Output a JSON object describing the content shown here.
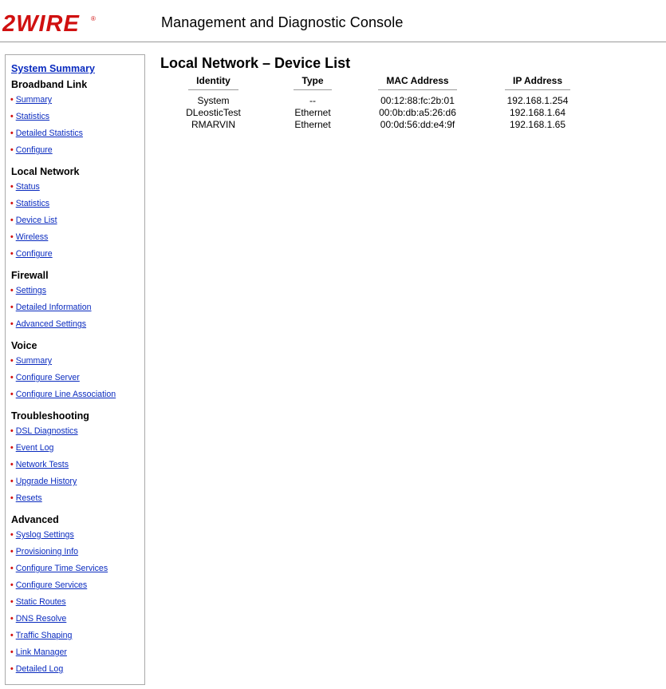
{
  "header": {
    "logo_text": "2WIRE",
    "title": "Management and Diagnostic Console"
  },
  "sidebar": {
    "summary_link": "System Summary",
    "sections": [
      {
        "heading": "Broadband Link",
        "items": [
          "Summary",
          "Statistics",
          "Detailed Statistics",
          "Configure"
        ]
      },
      {
        "heading": "Local Network",
        "items": [
          "Status",
          "Statistics",
          "Device List",
          "Wireless",
          "Configure"
        ]
      },
      {
        "heading": "Firewall",
        "items": [
          "Settings",
          "Detailed Information",
          "Advanced Settings"
        ]
      },
      {
        "heading": "Voice",
        "items": [
          "Summary",
          "Configure Server",
          "Configure Line Association"
        ]
      },
      {
        "heading": "Troubleshooting",
        "items": [
          "DSL Diagnostics",
          "Event Log",
          "Network Tests",
          "Upgrade History",
          "Resets"
        ]
      },
      {
        "heading": "Advanced",
        "items": [
          "Syslog Settings",
          "Provisioning Info",
          "Configure Time Services",
          "Configure Services",
          "Static Routes",
          "DNS Resolve",
          "Traffic Shaping",
          "Link Manager",
          "Detailed Log"
        ]
      }
    ]
  },
  "main": {
    "title": "Local Network – Device List",
    "columns": [
      "Identity",
      "Type",
      "MAC Address",
      "IP Address"
    ],
    "rows": [
      [
        "System",
        "--",
        "00:12:88:fc:2b:01",
        "192.168.1.254"
      ],
      [
        "DLeosticTest",
        "Ethernet",
        "00:0b:db:a5:26:d6",
        "192.168.1.64"
      ],
      [
        "RMARVIN",
        "Ethernet",
        "00:0d:56:dd:e4:9f",
        "192.168.1.65"
      ]
    ]
  },
  "colors": {
    "link": "#0a2bbf",
    "bullet": "#d01010",
    "logo": "#d01010"
  }
}
